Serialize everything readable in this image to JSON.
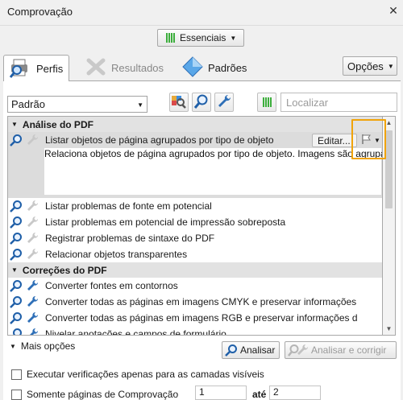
{
  "window": {
    "title": "Comprovação",
    "close_glyph": "✕"
  },
  "toolbar": {
    "profile_set": "Essenciais",
    "options_label": "Opções"
  },
  "tabs": [
    {
      "label": "Perfis",
      "icon": "printer-magnifier-icon",
      "active": true
    },
    {
      "label": "Resultados",
      "icon": "wrench-cross-icon",
      "active": false
    },
    {
      "label": "Padrões",
      "icon": "diamond-icon",
      "active": false
    }
  ],
  "filter": {
    "selected": "Padrão",
    "search_placeholder": "Localizar"
  },
  "tree": {
    "groups": [
      {
        "label": "Análise do PDF",
        "items": [
          {
            "label": "Listar objetos de página agrupados por tipo de objeto",
            "selected": true,
            "edit_label": "Editar...",
            "description": "Relaciona objetos de página agrupados por tipo de objeto. Imagens são agrupadas por resolução de imagem. Este perfil deve ser usado apenas para uma página por vez, pois ele pode informar um número muito grande de objetos de páginas."
          },
          {
            "label": "Listar problemas de fonte em potencial"
          },
          {
            "label": "Listar problemas em potencial de impressão sobreposta"
          },
          {
            "label": "Registrar problemas de sintaxe do PDF"
          },
          {
            "label": "Relacionar objetos transparentes"
          }
        ]
      },
      {
        "label": "Correções do PDF",
        "items": [
          {
            "label": "Converter fontes em contornos"
          },
          {
            "label": "Converter todas as páginas em imagens CMYK e preservar informações"
          },
          {
            "label": "Converter todas as páginas em imagens RGB e preservar informações d"
          },
          {
            "label": "Nivelar anotações e campos de formulário"
          }
        ]
      }
    ]
  },
  "footer": {
    "more_options": "Mais opções",
    "analyze": "Analisar",
    "analyze_fix": "Analisar e corrigir",
    "visible_layers": "Executar verificações apenas para as camadas visíveis",
    "pages_only": "Somente páginas de Comprovação",
    "page_from": "1",
    "page_to_label": "até",
    "page_to": "2"
  },
  "colors": {
    "highlight": "#f0a30a",
    "accent_green": "#3cae3c",
    "blue_icon": "#2e6fb7"
  }
}
